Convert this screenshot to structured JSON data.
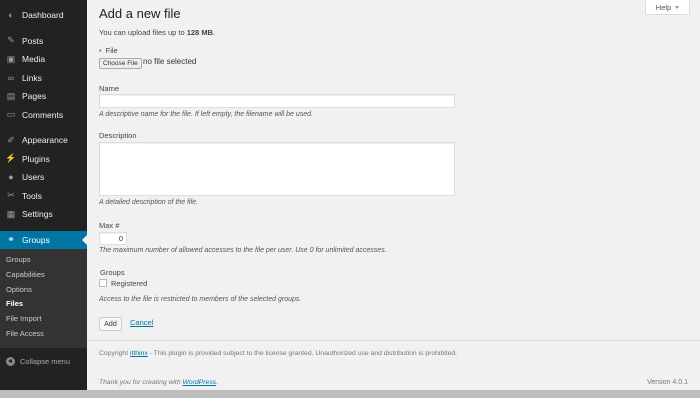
{
  "sidebar": {
    "items": [
      {
        "label": "Dashboard",
        "icon": "dashboard-icon",
        "glyph": "◐"
      },
      {
        "label": "Posts",
        "icon": "pushpin-icon",
        "glyph": "✎"
      },
      {
        "label": "Media",
        "icon": "media-icon",
        "glyph": "▣"
      },
      {
        "label": "Links",
        "icon": "links-icon",
        "glyph": "∞"
      },
      {
        "label": "Pages",
        "icon": "pages-icon",
        "glyph": "▤"
      },
      {
        "label": "Comments",
        "icon": "comments-icon",
        "glyph": "▭"
      },
      {
        "label": "Appearance",
        "icon": "appearance-icon",
        "glyph": "✐"
      },
      {
        "label": "Plugins",
        "icon": "plugins-icon",
        "glyph": "⚡"
      },
      {
        "label": "Users",
        "icon": "users-icon",
        "glyph": "●"
      },
      {
        "label": "Tools",
        "icon": "tools-icon",
        "glyph": "✂"
      },
      {
        "label": "Settings",
        "icon": "settings-icon",
        "glyph": "▦"
      },
      {
        "label": "Groups",
        "icon": "groups-icon",
        "glyph": "⚭"
      }
    ],
    "submenu": [
      "Groups",
      "Capabilities",
      "Options",
      "Files",
      "File Import",
      "File Access"
    ],
    "collapse_label": "Collapse menu"
  },
  "header": {
    "title": "Add a new file",
    "help_label": "Help"
  },
  "form": {
    "intro_prefix": "You can upload files up to ",
    "intro_size": "128 MB",
    "intro_suffix": ".",
    "required_mark": "•",
    "file_label": "File",
    "choose_file_label": "Choose File",
    "no_file_text": "no file selected",
    "name_label": "Name",
    "name_value": "",
    "name_desc": "A descriptive name for the file. If left empty, the filename will be used.",
    "description_label": "Description",
    "description_value": "",
    "description_desc": "A detailed description of the file.",
    "max_label": "Max #",
    "max_value": "0",
    "max_desc": "The maximum number of allowed accesses to the file per user. Use 0 for unlimited accesses.",
    "groups_label": "Groups",
    "group_option": "Registered",
    "groups_desc": "Access to the file is restricted to members of the selected groups.",
    "add_label": "Add",
    "cancel_label": "Cancel"
  },
  "footer": {
    "copyright_prefix": "Copyright ",
    "copyright_link": "itthinx",
    "copyright_suffix": " - This plugin is provided subject to the license granted. Unauthorized use and distribution is prohibited.",
    "thanks_prefix": "Thank you for creating with ",
    "thanks_link": "WordPress",
    "thanks_suffix": ".",
    "version": "Version 4.0.1"
  },
  "colors": {
    "sidebar_bg": "#222222",
    "active_bg": "#0074a2",
    "link": "#0074a2",
    "required": "#d54e21"
  }
}
